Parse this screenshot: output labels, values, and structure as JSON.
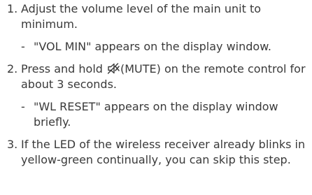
{
  "steps": [
    {
      "number": "1.",
      "text": "Adjust the volume level of the main unit to minimum.",
      "note": {
        "dash": "-",
        "text": "\"VOL MIN\" appears on the display window."
      }
    },
    {
      "number": "2.",
      "text_before_icon": "Press and hold ",
      "icon": "mute-icon",
      "text_after_icon": "(MUTE) on the remote control for about 3 seconds.",
      "note": {
        "dash": "-",
        "text": "\"WL RESET\" appears on the display window briefly."
      }
    },
    {
      "number": "3.",
      "text": "If the LED of the wireless receiver already blinks in yellow-green continually, you can skip this step."
    }
  ]
}
